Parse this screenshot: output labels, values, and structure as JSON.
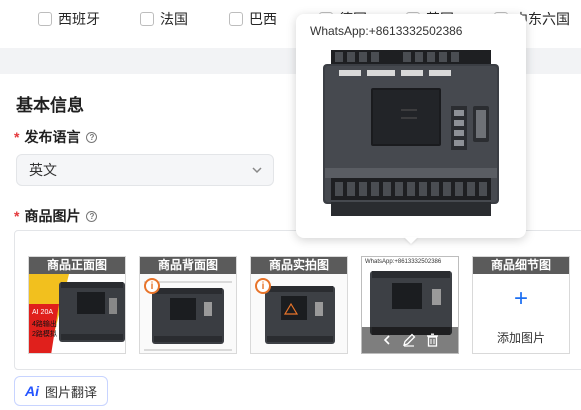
{
  "countries": [
    {
      "label": "西班牙"
    },
    {
      "label": "法国"
    },
    {
      "label": "巴西"
    },
    {
      "label": "德国"
    },
    {
      "label": "英国"
    },
    {
      "label": "中东六国"
    }
  ],
  "basic_info": {
    "title": "基本信息",
    "language_label": "发布语言",
    "language_value": "英文",
    "images_label": "商品图片"
  },
  "image_slots": [
    {
      "tag": "商品正面图"
    },
    {
      "tag": "商品背面图"
    },
    {
      "tag": "商品实拍图"
    },
    {
      "tag": ""
    },
    {
      "tag": "商品细节图"
    }
  ],
  "add_image_label": "添加图片",
  "preview": {
    "watermark": "WhatsApp:+8613332502386"
  },
  "thumb4_watermark": "WhatsApp:+8613332502386",
  "ai_button": {
    "mark": "Ai",
    "label": "图片翻译"
  },
  "front_image_labels": [
    "AI 20A",
    "4路输出",
    "2路模拟"
  ]
}
